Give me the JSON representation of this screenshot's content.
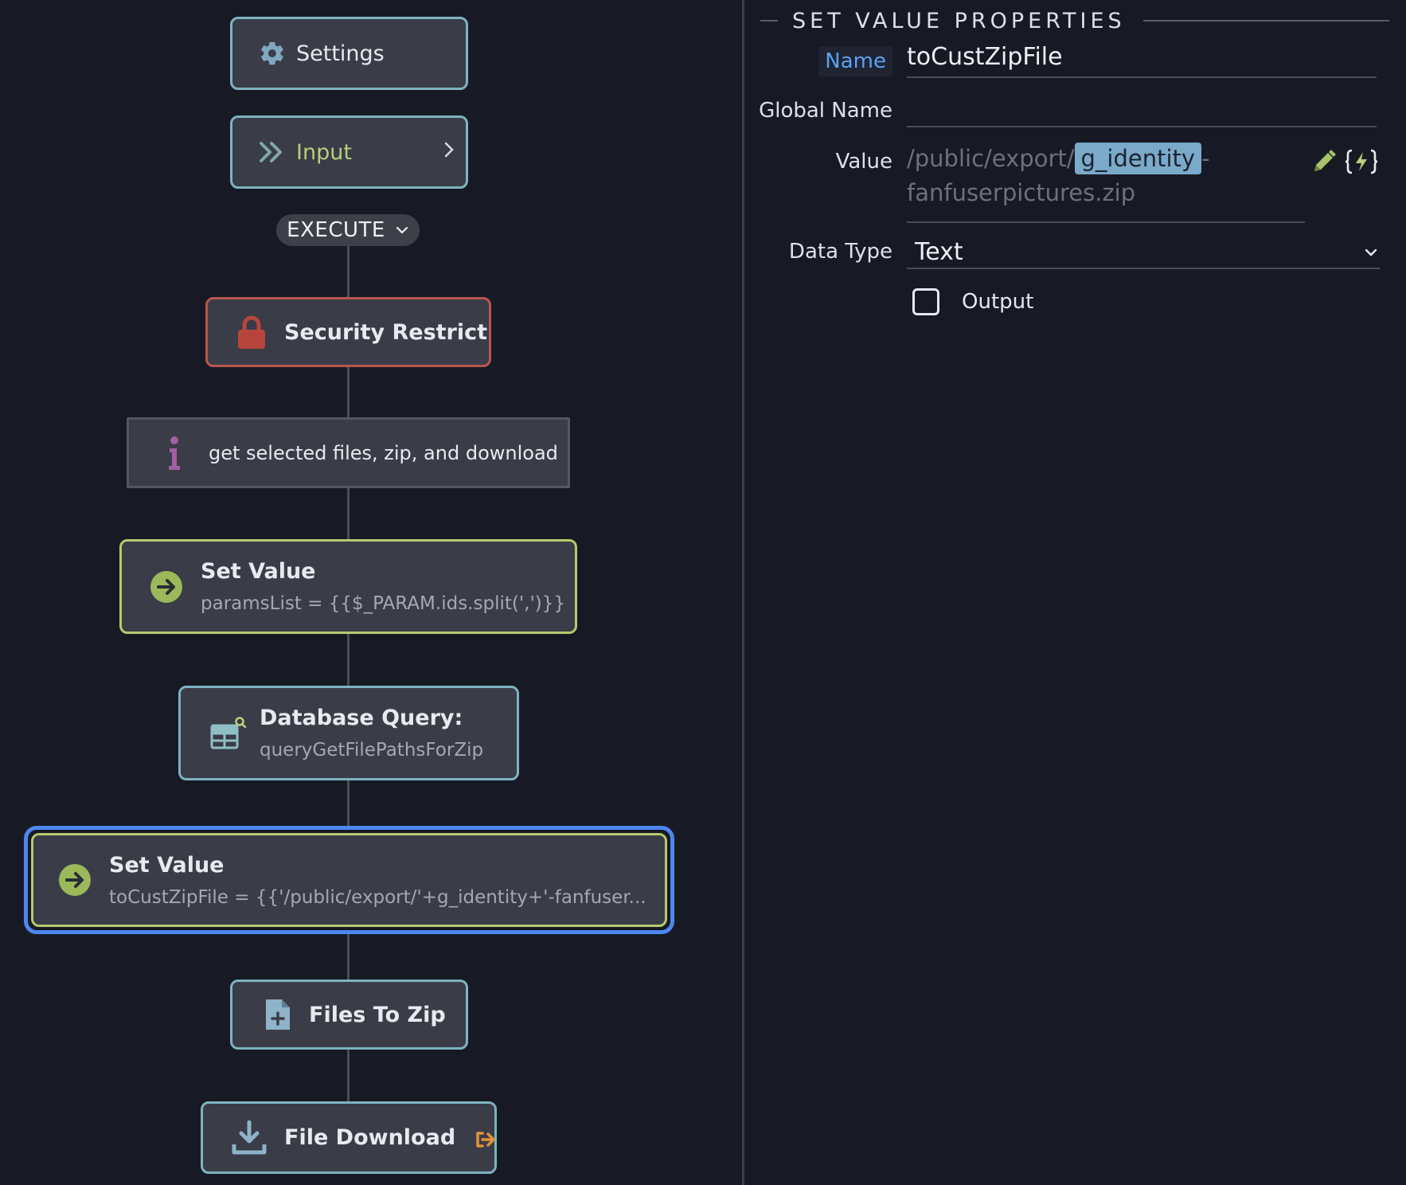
{
  "flow": {
    "settings": {
      "label": "Settings"
    },
    "input": {
      "label": "Input"
    },
    "execute": {
      "label": "EXECUTE"
    },
    "security": {
      "label": "Security Restrict"
    },
    "comment": {
      "label": "get selected files, zip, and download"
    },
    "set_value_1": {
      "label": "Set Value",
      "detail": "paramsList = {{$_PARAM.ids.split(',')}}"
    },
    "db_query": {
      "label": "Database Query:",
      "detail": "queryGetFilePathsForZip"
    },
    "set_value_2": {
      "label": "Set Value",
      "detail": "toCustZipFile = {{'/public/export/'+g_identity+'-fanfuser..."
    },
    "files_to_zip": {
      "label": "Files To Zip"
    },
    "file_download": {
      "label": "File Download"
    }
  },
  "panel": {
    "title": "SET VALUE PROPERTIES",
    "name_label": "Name",
    "name_value": "toCustZipFile",
    "global_name_label": "Global Name",
    "global_name_value": "",
    "value_label": "Value",
    "value_prefix": "/public/export/",
    "value_token": "g_identity",
    "value_suffix": "-fanfuserpictures.zip",
    "data_type_label": "Data Type",
    "data_type_value": "Text",
    "output_label": "Output",
    "output_checked": false
  },
  "colors": {
    "background": "#171a25",
    "node_fill": "#3a3c47",
    "node_border_teal": "#7fb2c0",
    "node_border_green": "#b7c96c",
    "node_border_red": "#b8564d",
    "selection_blue": "#4d86f0",
    "accent_link": "#5aa2f0",
    "token_bg": "#7aa9c9"
  },
  "icons": {
    "settings": "gear-icon",
    "input": "double-chevron-right-icon",
    "security": "lock-icon",
    "comment": "info-icon",
    "set_value": "arrow-circle-right-icon",
    "db_query": "table-search-icon",
    "files_to_zip": "file-plus-icon",
    "file_download": "download-icon",
    "file_download_badge": "exit-arrow-icon",
    "edit": "pencil-icon",
    "expression": "braces-bolt-icon"
  }
}
